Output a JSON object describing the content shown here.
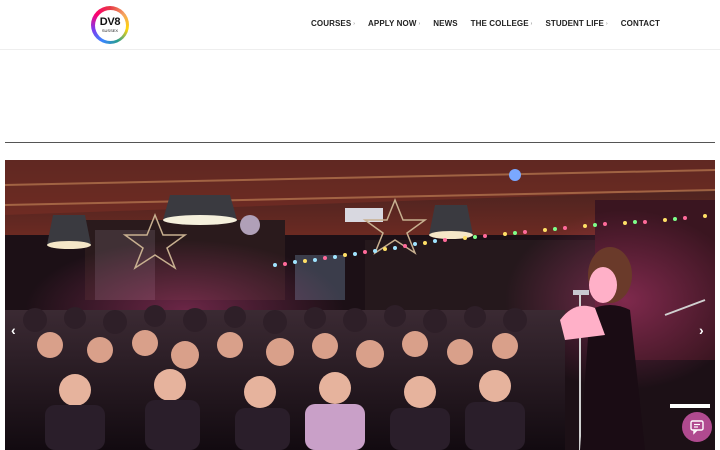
{
  "logo": {
    "text": "DV8",
    "sub": "SUSSEX"
  },
  "nav": {
    "items": [
      {
        "label": "COURSES",
        "has_dropdown": true
      },
      {
        "label": "APPLY NOW",
        "has_dropdown": true
      },
      {
        "label": "NEWS",
        "has_dropdown": false
      },
      {
        "label": "THE COLLEGE",
        "has_dropdown": true
      },
      {
        "label": "STUDENT LIFE",
        "has_dropdown": true
      },
      {
        "label": "CONTACT",
        "has_dropdown": false
      }
    ]
  },
  "hero": {
    "icons": {
      "prev": "chevron-left-icon",
      "next": "chevron-right-icon"
    }
  },
  "chat": {
    "icon": "chat-bubble-icon"
  }
}
